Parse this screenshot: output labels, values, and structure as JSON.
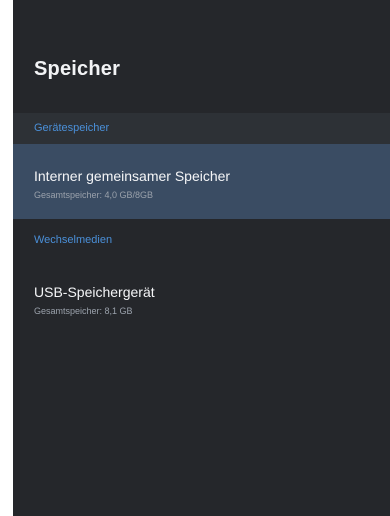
{
  "header": {
    "title": "Speicher"
  },
  "sections": [
    {
      "label": "Gerätespeicher",
      "items": [
        {
          "title": "Interner gemeinsamer Speicher",
          "subtitle": "Gesamtspeicher: 4,0 GB/8GB"
        }
      ]
    },
    {
      "label": "Wechselmedien",
      "items": [
        {
          "title": "USB-Speichergerät",
          "subtitle": "Gesamtspeicher: 8,1 GB"
        }
      ]
    }
  ],
  "colors": {
    "background": "#25272b",
    "section_label": "#4a8fd8",
    "selected_item": "#3a4c63"
  }
}
